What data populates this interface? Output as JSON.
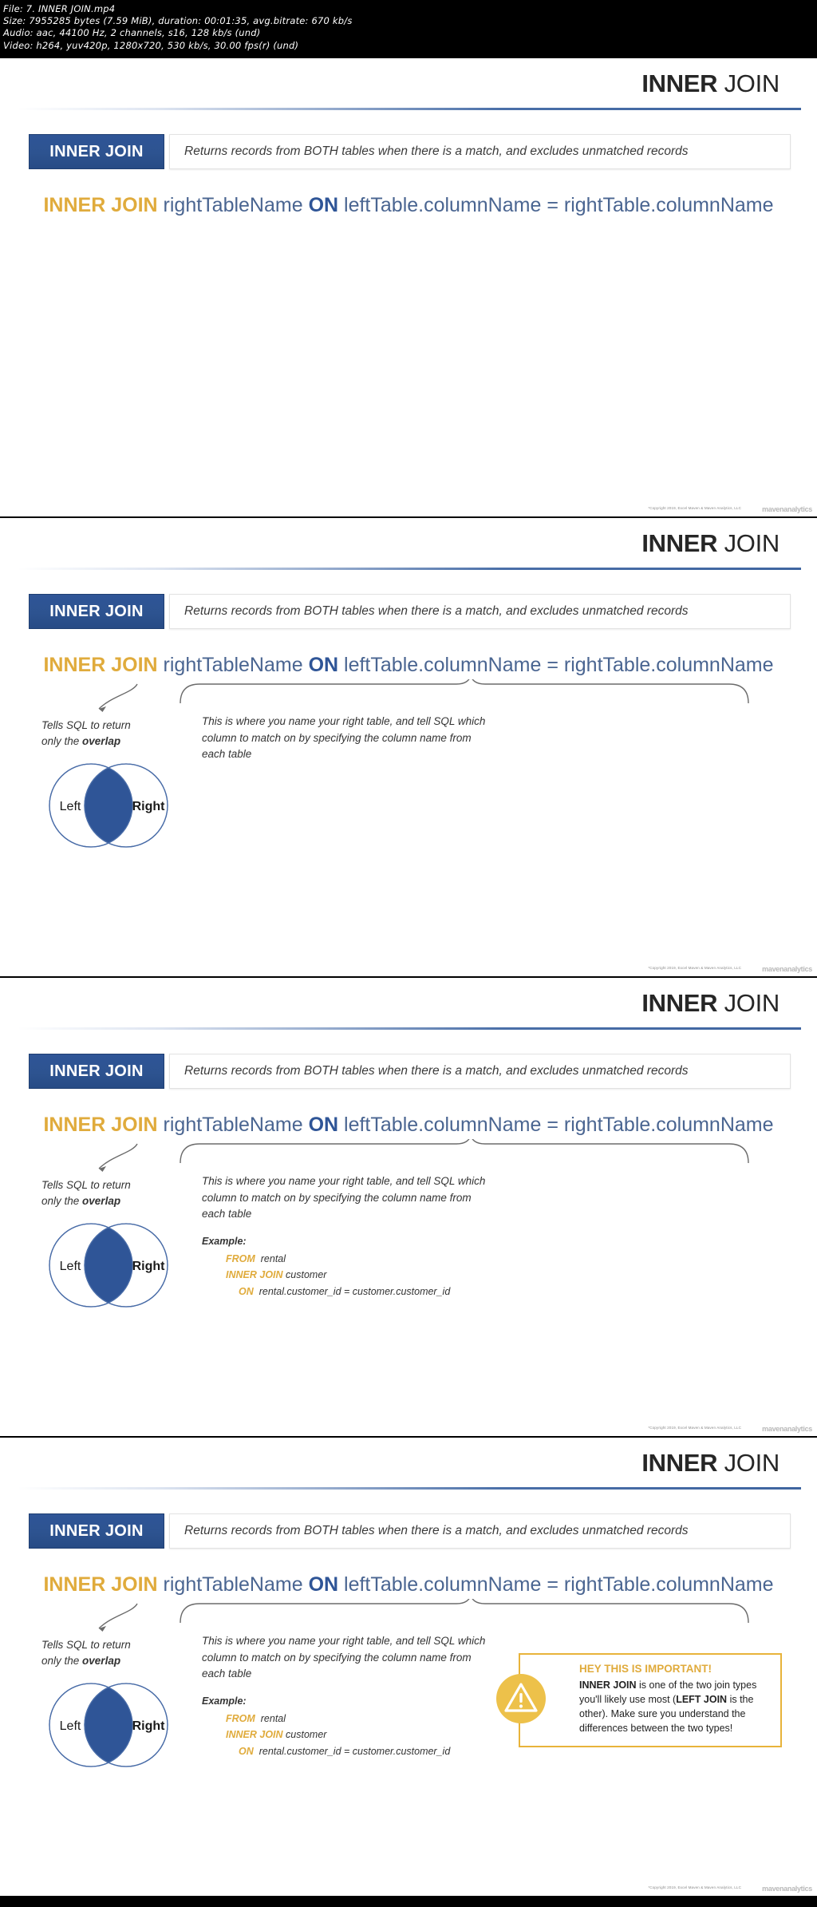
{
  "metadata": {
    "line1": "File: 7. INNER JOIN.mp4",
    "line2": "Size: 7955285 bytes (7.59 MiB), duration: 00:01:35, avg.bitrate: 670 kb/s",
    "line3": "Audio: aac, 44100 Hz, 2 channels, s16, 128 kb/s (und)",
    "line4": "Video: h264, yuv420p, 1280x720, 530 kb/s, 30.00 fps(r) (und)"
  },
  "slide": {
    "title_bold": "INNER",
    "title_normal": " JOIN",
    "badge": "INNER JOIN",
    "description": "Returns records from BOTH tables when there is a match, and excludes unmatched records",
    "syntax": {
      "keyword": "INNER JOIN",
      "right_table": "rightTableName",
      "on": "ON",
      "left_col": "leftTable.columnName",
      "equals": "=",
      "right_col": "rightTable.columnName"
    },
    "annotation_left": {
      "line1": "Tells SQL to return",
      "line2_prefix": "only the ",
      "line2_bold": "overlap"
    },
    "venn": {
      "left_label": "Left",
      "right_label": "Right"
    },
    "annotation_mid": "This is where you name your right table, and tell SQL which column to match on by specifying the column name from each table",
    "example": {
      "heading": "Example:",
      "kw1": "FROM",
      "val1": "rental",
      "kw2": "INNER JOIN",
      "val2": "customer",
      "kw3": "ON",
      "val3": "rental.customer_id = customer.customer_id"
    },
    "callout": {
      "heading": "HEY THIS IS IMPORTANT!",
      "body_a": "INNER JOIN",
      "body_b": " is one of the two join types you'll likely use most (",
      "body_c": "LEFT JOIN",
      "body_d": " is the other). Make sure you understand the differences between the two types!",
      "icon": "warning-triangle-icon"
    },
    "copyright": "*Copyright 2019, Excel Maven & Maven Analytics, LLC",
    "watermark": "mavenanalytics"
  },
  "colors": {
    "badge_blue": "#2f5597",
    "accent_gold": "#e0ab3c",
    "syntax_blue": "#3b5a8c",
    "venn_fill": "#2f5597",
    "callout_border": "#e8b33a"
  },
  "frames": [
    {
      "id": "frame-1",
      "show_annotations": false,
      "show_example": false,
      "show_callout": false
    },
    {
      "id": "frame-2",
      "show_annotations": true,
      "show_example": false,
      "show_callout": false
    },
    {
      "id": "frame-3",
      "show_annotations": true,
      "show_example": true,
      "show_callout": false
    },
    {
      "id": "frame-4",
      "show_annotations": true,
      "show_example": true,
      "show_callout": true
    }
  ]
}
